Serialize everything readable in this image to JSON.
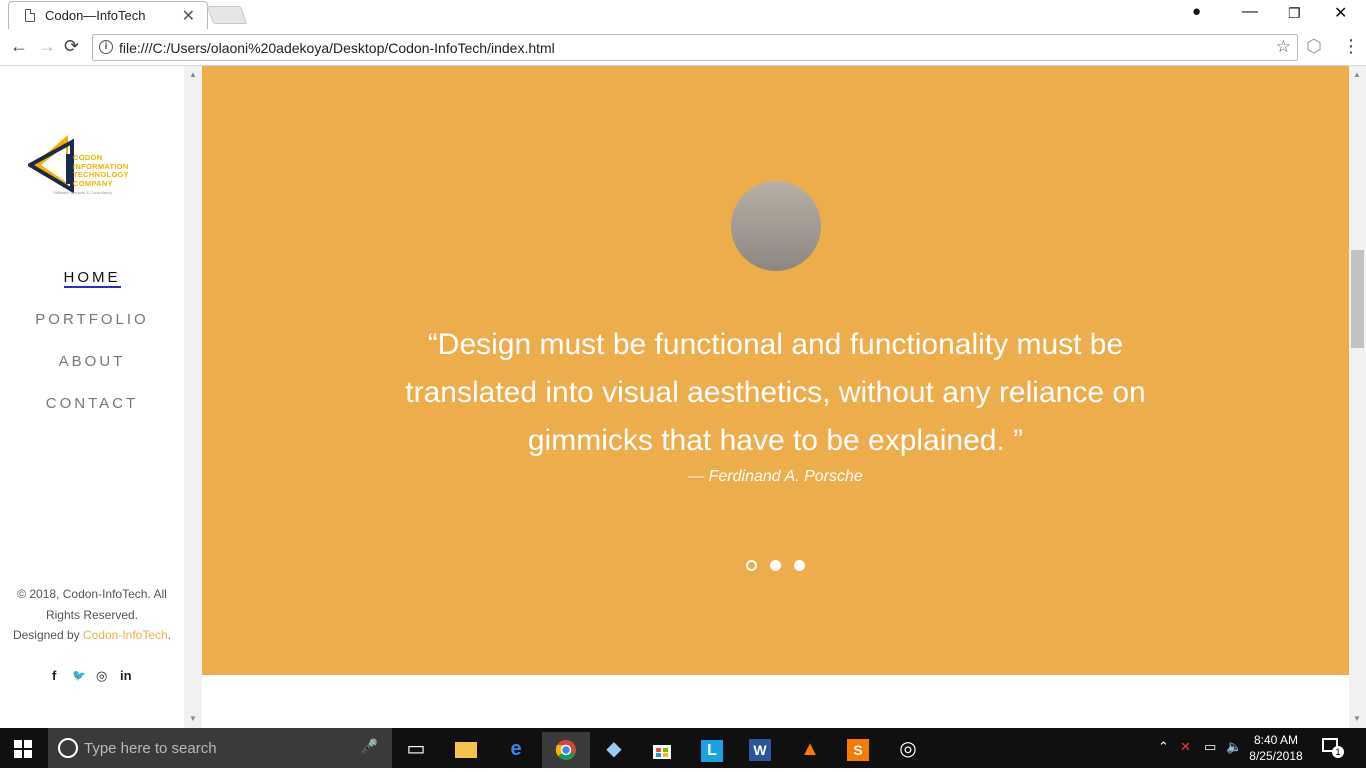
{
  "browser": {
    "tab_title": "Codon—InfoTech",
    "close_glyph": "✕",
    "url": "file:///C:/Users/olaoni%20adekoya/Desktop/Codon-InfoTech/index.html",
    "back_glyph": "←",
    "forward_glyph": "→",
    "reload_glyph": "⟳",
    "info_glyph": "i",
    "star_glyph": "☆",
    "extension_glyph": "⬡",
    "menu_glyph": "⋮",
    "profile_glyph": "●",
    "minimize_glyph": "—",
    "maximize_glyph": "❐",
    "winclose_glyph": "✕"
  },
  "sidebar": {
    "logo": {
      "line1": "CODON",
      "line2": "INFORMATION",
      "line3": "TECHNOLOGY",
      "line4": "COMPANY",
      "tagline": "Software Services & Consultancy"
    },
    "nav": [
      {
        "label": "HOME",
        "active": true
      },
      {
        "label": "PORTFOLIO",
        "active": false
      },
      {
        "label": "ABOUT",
        "active": false
      },
      {
        "label": "CONTACT",
        "active": false
      }
    ],
    "footer": {
      "copyright": "© 2018, Codon-InfoTech. All Rights Reserved.",
      "designed_by": "Designed by ",
      "brand": "Codon-InfoTech",
      "period": "."
    },
    "social": {
      "facebook": "f",
      "twitter": "🐦",
      "instagram": "◎",
      "linkedin": "in"
    }
  },
  "hero": {
    "quote": "“Design must be functional and functionality must be translated into visual aesthetics, without any reliance on gimmicks that have to be explained. ”",
    "author": "— Ferdinand A. Porsche",
    "slide_count": 3,
    "active_slide": 1,
    "background_color": "#eead4d"
  },
  "taskbar": {
    "search_placeholder": "Type here to search",
    "mic_glyph": "🎤",
    "time": "8:40 AM",
    "date": "8/25/2018",
    "apps": [
      "task-view",
      "file-explorer",
      "edge",
      "chrome",
      "box",
      "store",
      "lens",
      "word",
      "vlc",
      "sublime",
      "groove"
    ],
    "notification_count": "1"
  }
}
